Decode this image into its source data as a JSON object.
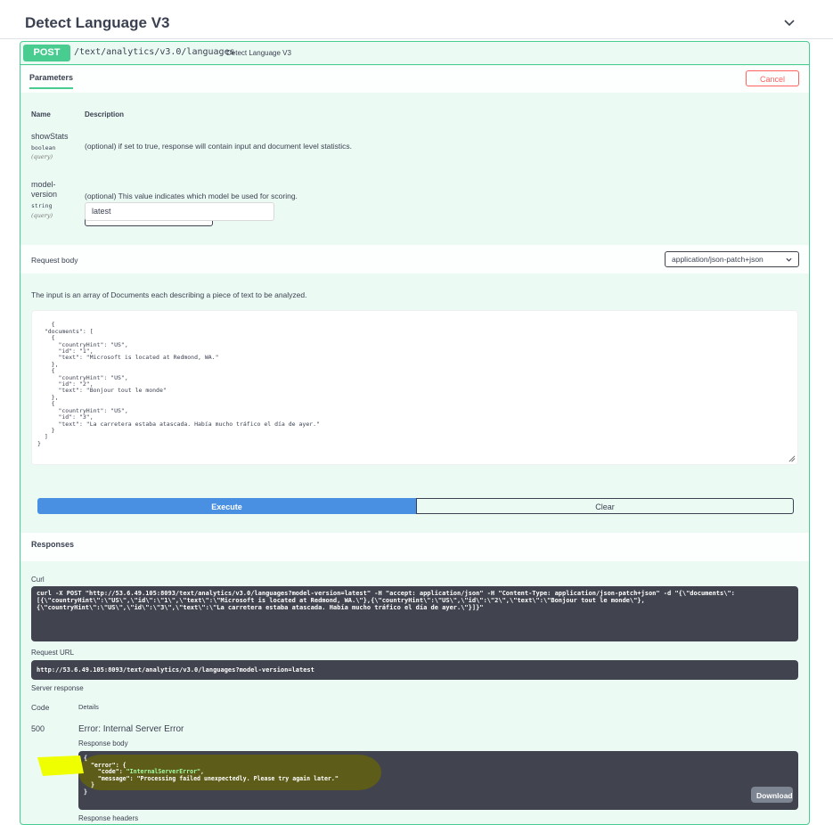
{
  "section": {
    "title": "Detect Language V3"
  },
  "operation": {
    "method": "POST",
    "path": "/text/analytics/v3.0/languages",
    "summary": "Detect Language V3"
  },
  "tabs": {
    "parameters": "Parameters",
    "cancel": "Cancel"
  },
  "params_table": {
    "col_name": "Name",
    "col_description": "Description"
  },
  "params": [
    {
      "name": "showStats",
      "type": "boolean",
      "in": "(query)",
      "description": "(optional) if set to true, response will contain input and document level statistics.",
      "selected": "--"
    },
    {
      "name_line1": "model-",
      "name_line2": "version",
      "type": "string",
      "in": "(query)",
      "description": "(optional) This value indicates which model be used for scoring.",
      "value": "latest"
    }
  ],
  "request_body": {
    "label": "Request body",
    "content_type": "application/json-patch+json",
    "description": "The input is an array of Documents each describing a piece of text to be analyzed.",
    "example": "{\n  \"documents\": [\n    {\n      \"countryHint\": \"US\",\n      \"id\": \"1\",\n      \"text\": \"Microsoft is located at Redmond, WA.\"\n    },\n    {\n      \"countryHint\": \"US\",\n      \"id\": \"2\",\n      \"text\": \"Bonjour tout le monde\"\n    },\n    {\n      \"countryHint\": \"US\",\n      \"id\": \"3\",\n      \"text\": \"La carretera estaba atascada. Había mucho tráfico el día de ayer.\"\n    }\n  ]\n}"
  },
  "actions": {
    "execute": "Execute",
    "clear": "Clear"
  },
  "responses": {
    "title": "Responses",
    "curl_label": "Curl",
    "curl": "curl -X POST \"http://53.6.49.105:8093/text/analytics/v3.0/languages?model-version=latest\" -H \"accept: application/json\" -H \"Content-Type: application/json-patch+json\" -d \"{\\\"documents\\\":\n[{\\\"countryHint\\\":\\\"US\\\",\\\"id\\\":\\\"1\\\",\\\"text\\\":\\\"Microsoft is located at Redmond, WA.\\\"},{\\\"countryHint\\\":\\\"US\\\",\\\"id\\\":\\\"2\\\",\\\"text\\\":\\\"Bonjour tout le monde\\\"},\n{\\\"countryHint\\\":\\\"US\\\",\\\"id\\\":\\\"3\\\",\\\"text\\\":\\\"La carretera estaba atascada. Había mucho tráfico el día de ayer.\\\"}]}\"",
    "request_url_label": "Request URL",
    "request_url": "http://53.6.49.105:8093/text/analytics/v3.0/languages?model-version=latest",
    "server_response_label": "Server response",
    "col_code": "Code",
    "col_details": "Details",
    "status_code": "500",
    "status_text": "Error: Internal Server Error",
    "response_body_label": "Response body",
    "response_body": {
      "open_brace": "{",
      "error_key": "\"error\": {",
      "code_key": "\"code\": ",
      "code_value": "\"InternalServerError\"",
      "message_key": "\"message\": ",
      "message_value": "\"Processing failed unexpectedly. Please try again later.\"",
      "inner_close": "}",
      "outer_close": "}"
    },
    "download": "Download",
    "response_headers_label": "Response headers"
  },
  "colors": {
    "post_green": "#49cc90",
    "execute_blue": "#4990e2",
    "cancel_red": "#ff6060",
    "code_bg": "#41444e"
  }
}
